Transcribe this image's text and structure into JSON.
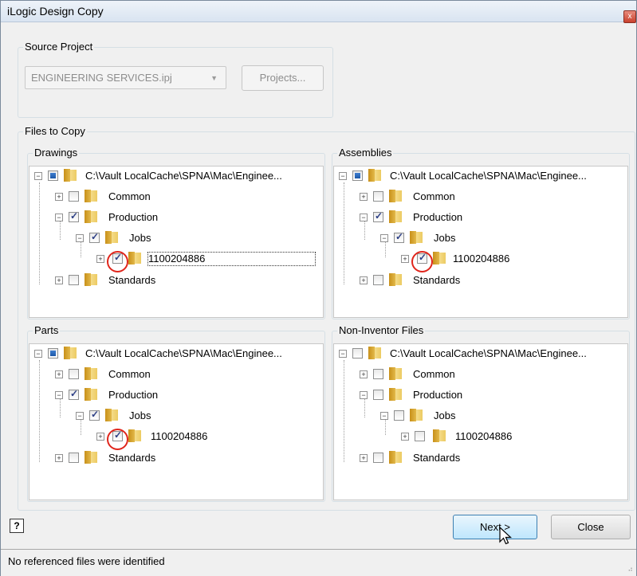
{
  "window": {
    "title": "iLogic Design Copy",
    "close_glyph": "x"
  },
  "source_project": {
    "group_label": "Source Project",
    "combo_value": "ENGINEERING SERVICES.ipj",
    "projects_button": "Projects..."
  },
  "files_to_copy": {
    "group_label": "Files to Copy"
  },
  "panels": {
    "drawings": {
      "label": "Drawings",
      "root": "C:\\Vault LocalCache\\SPNA\\Mac\\Enginee...",
      "common": "Common",
      "production": "Production",
      "jobs": "Jobs",
      "job_number": "1100204886",
      "standards": "Standards"
    },
    "assemblies": {
      "label": "Assemblies",
      "root": "C:\\Vault LocalCache\\SPNA\\Mac\\Enginee...",
      "common": "Common",
      "production": "Production",
      "jobs": "Jobs",
      "job_number": "1100204886",
      "standards": "Standards"
    },
    "parts": {
      "label": "Parts",
      "root": "C:\\Vault LocalCache\\SPNA\\Mac\\Enginee...",
      "common": "Common",
      "production": "Production",
      "jobs": "Jobs",
      "job_number": "1100204886",
      "standards": "Standards"
    },
    "non_inventor": {
      "label": "Non-Inventor Files",
      "root": "C:\\Vault LocalCache\\SPNA\\Mac\\Enginee...",
      "common": "Common",
      "production": "Production",
      "jobs": "Jobs",
      "job_number": "1100204886",
      "standards": "Standards"
    }
  },
  "buttons": {
    "help": "?",
    "next": "Next >",
    "close": "Close"
  },
  "status": {
    "message": "No referenced files were identified"
  },
  "colors": {
    "accent": "#3c7fb1",
    "highlight_circle": "#e0251b",
    "folder": "#e3b94a"
  },
  "icons": [
    "folder-icon",
    "checkbox-icon",
    "expand-plus-icon",
    "collapse-minus-icon",
    "help-icon",
    "mouse-cursor-icon",
    "close-icon",
    "dropdown-arrow-icon"
  ]
}
